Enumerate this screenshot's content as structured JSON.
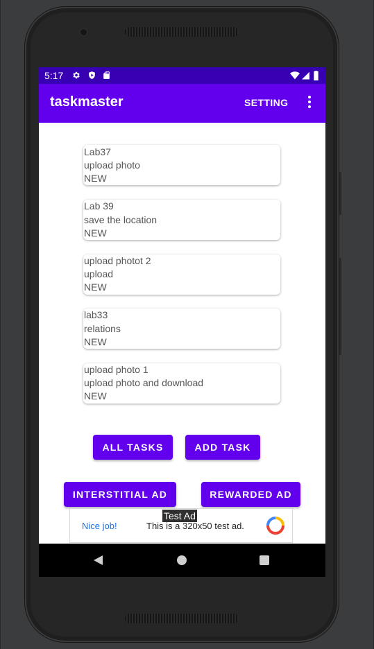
{
  "status_bar": {
    "time": "5:17"
  },
  "app_bar": {
    "title": "taskmaster",
    "setting_label": "SETTING"
  },
  "tasks": [
    {
      "title": "Lab37",
      "body": "upload photo",
      "state": "NEW"
    },
    {
      "title": "Lab 39",
      "body": "save the location",
      "state": "NEW"
    },
    {
      "title": "upload photot 2",
      "body": "upload",
      "state": "NEW"
    },
    {
      "title": "lab33",
      "body": "relations",
      "state": "NEW"
    },
    {
      "title": "upload photo 1",
      "body": "upload photo and download",
      "state": "NEW"
    }
  ],
  "buttons": {
    "all_tasks": "ALL TASKS",
    "add_task": "ADD TASK",
    "interstitial_ad": "INTERSTITIAL AD",
    "rewarded_ad": "REWARDED AD"
  },
  "ad": {
    "label": "Test Ad",
    "nice_job": "Nice job!",
    "message": "This is a 320x50 test ad."
  },
  "colors": {
    "primary": "#6200ee",
    "primary_dark": "#3700b3",
    "link": "#1a73e8"
  }
}
